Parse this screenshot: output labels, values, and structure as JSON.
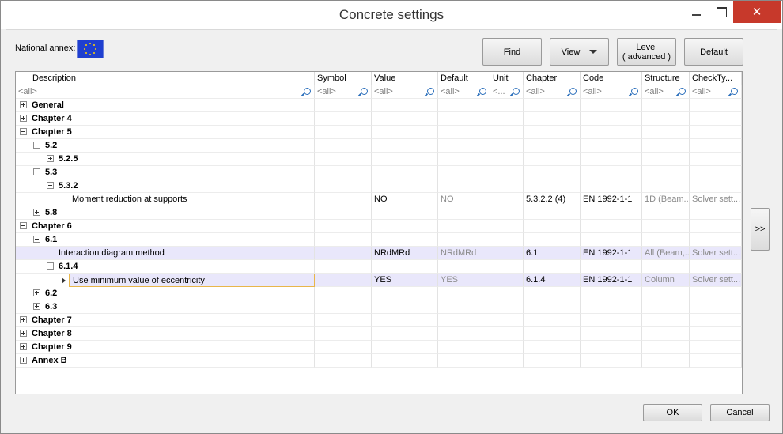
{
  "window": {
    "title": "Concrete settings"
  },
  "national_annex": {
    "label": "National annex:"
  },
  "toolbar": {
    "find": "Find",
    "view": "View",
    "level_line1": "Level",
    "level_line2": "( advanced )",
    "default": "Default"
  },
  "columns": [
    "Description",
    "Symbol",
    "Value",
    "Default",
    "Unit",
    "Chapter",
    "Code",
    "Structure",
    "CheckTy..."
  ],
  "filters": [
    "<all>",
    "<all>",
    "<all>",
    "<all>",
    "<...",
    "<all>",
    "<all>",
    "<all>",
    "<all>"
  ],
  "rows": [
    {
      "desc": "General"
    },
    {
      "desc": "Chapter 4"
    },
    {
      "desc": "Chapter 5"
    },
    {
      "desc": "5.2"
    },
    {
      "desc": "5.2.5"
    },
    {
      "desc": "5.3"
    },
    {
      "desc": "5.3.2"
    },
    {
      "desc": "Moment reduction at supports",
      "value": "NO",
      "default": "NO",
      "chapter": "5.3.2.2 (4)",
      "code": "EN 1992-1-1",
      "structure": "1D (Beam...",
      "check": "Solver sett..."
    },
    {
      "desc": "5.8"
    },
    {
      "desc": "Chapter 6"
    },
    {
      "desc": "6.1"
    },
    {
      "desc": "Interaction diagram method",
      "value": "NRdMRd",
      "default": "NRdMRd",
      "chapter": "6.1",
      "code": "EN 1992-1-1",
      "structure": "All (Beam,...",
      "check": "Solver sett..."
    },
    {
      "desc": "6.1.4"
    },
    {
      "desc": "Use minimum value of eccentricity",
      "value": "YES",
      "default": "YES",
      "chapter": "6.1.4",
      "code": "EN 1992-1-1",
      "structure": "Column",
      "check": "Solver sett..."
    },
    {
      "desc": "6.2"
    },
    {
      "desc": "6.3"
    },
    {
      "desc": "Chapter 7"
    },
    {
      "desc": "Chapter 8"
    },
    {
      "desc": "Chapter 9"
    },
    {
      "desc": "Annex B"
    }
  ],
  "side_button": ">>",
  "footer": {
    "ok": "OK",
    "cancel": "Cancel"
  },
  "colors": {
    "selected_row": "#e9e7fb",
    "close_button": "#c7392b",
    "focus_border": "#e8b64a"
  }
}
